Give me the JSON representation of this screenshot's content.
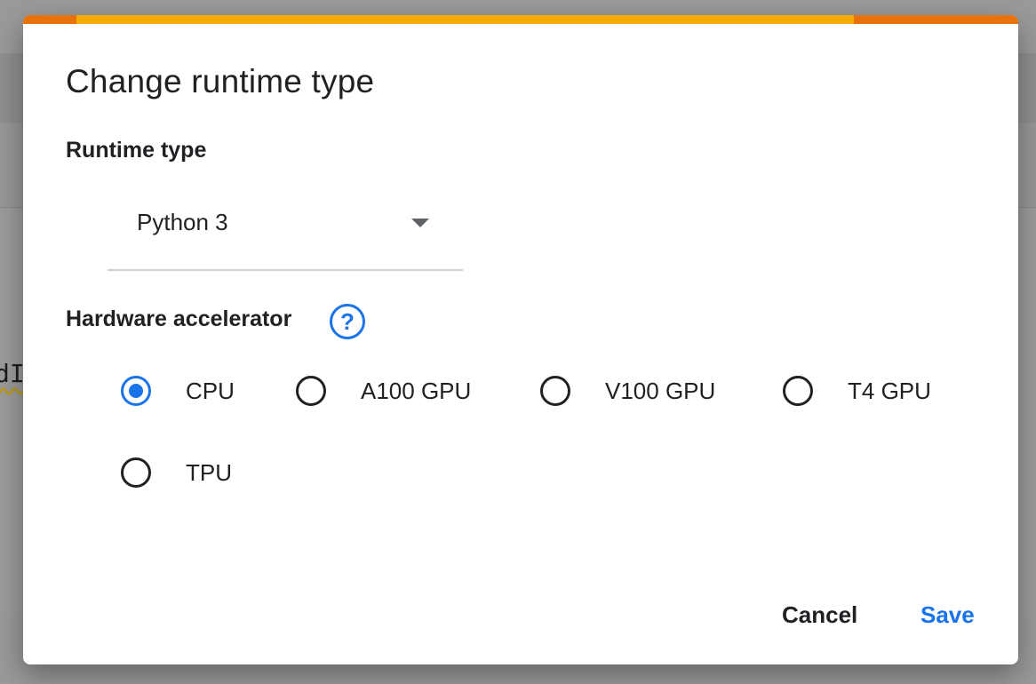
{
  "background": {
    "code_fragment": "dI"
  },
  "dialog": {
    "title": "Change runtime type",
    "runtime": {
      "label": "Runtime type",
      "selected": "Python 3"
    },
    "hardware": {
      "label": "Hardware accelerator",
      "help_icon": "help-circle-icon",
      "help_glyph": "?",
      "options": [
        {
          "label": "CPU",
          "checked": true
        },
        {
          "label": "A100 GPU",
          "checked": false
        },
        {
          "label": "V100 GPU",
          "checked": false
        },
        {
          "label": "T4 GPU",
          "checked": false
        },
        {
          "label": "TPU",
          "checked": false
        }
      ]
    },
    "actions": {
      "cancel": "Cancel",
      "save": "Save"
    }
  },
  "colors": {
    "accent": "#1a73e8",
    "bar_orange": "#e8710a",
    "bar_yellow": "#f9ab00"
  }
}
